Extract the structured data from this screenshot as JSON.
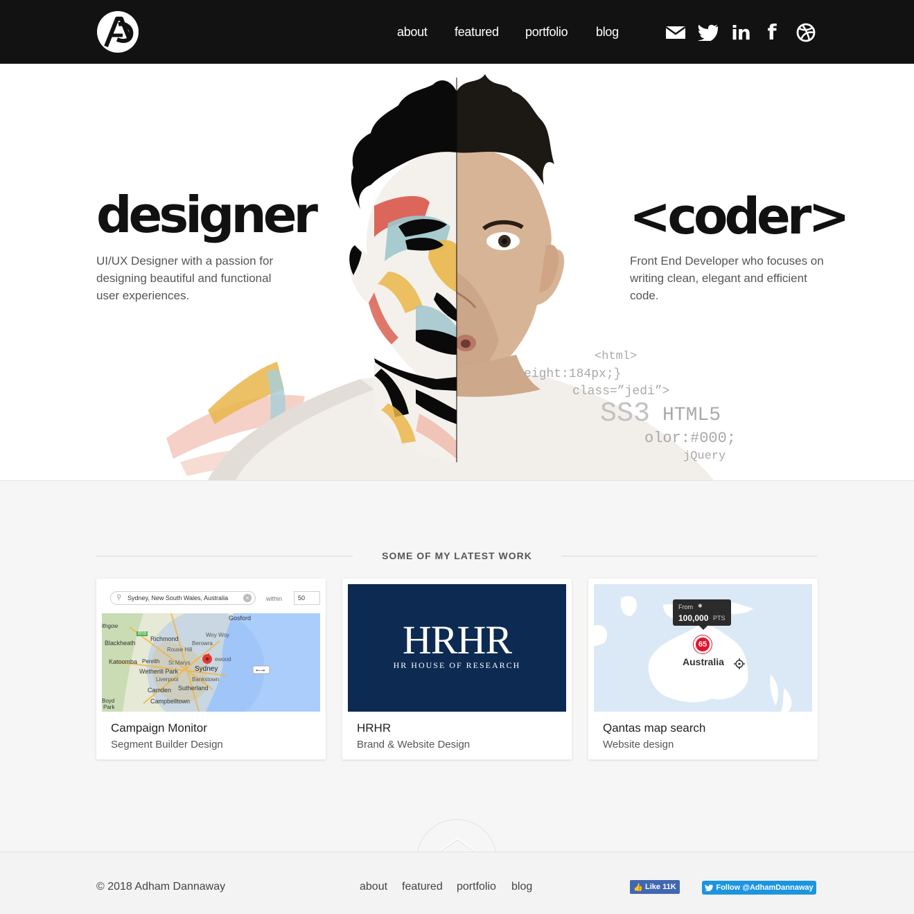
{
  "header": {
    "logo_alt": "AD",
    "nav": [
      "about",
      "featured",
      "portfolio",
      "blog"
    ],
    "social_icons": [
      "mail-icon",
      "twitter-icon",
      "linkedin-icon",
      "facebook-icon",
      "dribbble-icon"
    ]
  },
  "hero": {
    "left_title": "designer",
    "left_desc": "UI/UX Designer with a passion for designing beautiful and functional user experiences.",
    "right_title": "<coder>",
    "right_desc": "Front End Developer who focuses on writing clean, elegant and efficient code.",
    "code_snippets": [
      "<html>",
      "eight:184px;}",
      "class=”jedi”>",
      "SS3",
      "HTML5",
      "olor:#000;",
      "jQuery"
    ]
  },
  "work": {
    "heading": "SOME OF MY LATEST WORK",
    "cards": [
      {
        "title": "Campaign Monitor",
        "subtitle": "Segment Builder Design",
        "search_value": "Sydney, New South Wales, Australia",
        "within_label": "within",
        "within_value": "50",
        "map_labels": [
          "Gosford",
          "ithgow",
          "Richmond",
          "Woy Woy",
          "Blackheath",
          "Berowra",
          "Rouse Hill",
          "Katoomba",
          "Penrith",
          "St Marys",
          "Sydney",
          "Wetherill Park",
          "Liverpool",
          "Bankstown",
          "Camden",
          "Sutherland",
          "Campbelltown",
          "Boyd",
          "Park",
          "B59",
          "ewood"
        ]
      },
      {
        "title": "HRHR",
        "subtitle": "Brand & Website Design",
        "logo_text": "HRHR",
        "logo_sub": "HR HOUSE OF RESEARCH"
      },
      {
        "title": "Qantas map search",
        "subtitle": "Website design",
        "tooltip_from": "From",
        "tooltip_value": "100,000",
        "tooltip_unit": "PTS",
        "marker_value": "65",
        "region_label": "Australia"
      }
    ]
  },
  "footer": {
    "copyright": "© 2018 Adham Dannaway",
    "nav": [
      "about",
      "featured",
      "portfolio",
      "blog"
    ],
    "fb_like": "Like 11K",
    "tw_follow": "Follow @AdhamDannaway"
  },
  "colors": {
    "header_bg": "#121212",
    "hrhr_navy": "#0d2a52",
    "fb_blue": "#4267b2",
    "tw_blue": "#1b95e0"
  }
}
